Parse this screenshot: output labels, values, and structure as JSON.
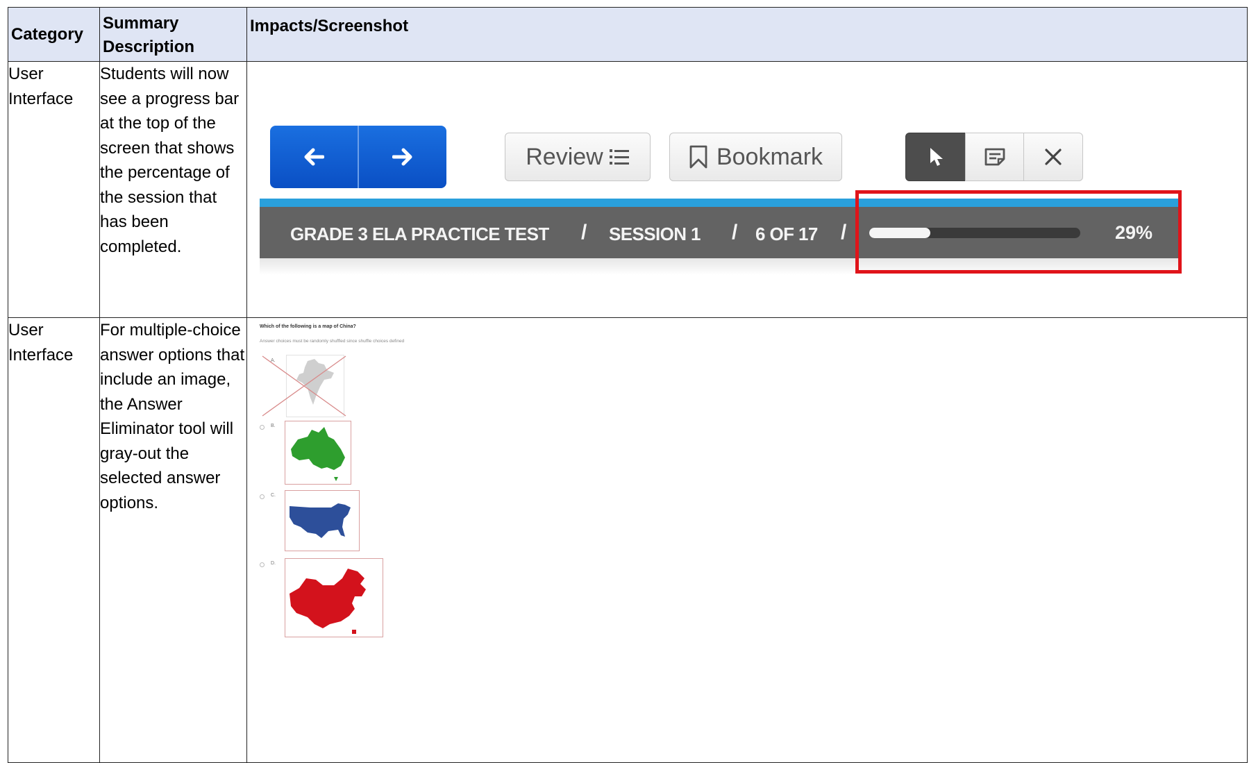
{
  "table": {
    "headers": [
      "Category",
      "Summary Description",
      "Impacts/Screenshot"
    ],
    "rows": [
      {
        "category": "User Interface",
        "summary": "Students will now see a progress bar at the top of the screen that shows the percentage of the session that has been completed."
      },
      {
        "category": "User Interface",
        "summary": "For multiple-choice answer options that include an image, the Answer Eliminator tool will gray-out the selected answer options."
      }
    ]
  },
  "screenshot1": {
    "icons": {
      "prev": "arrow-left-icon",
      "next": "arrow-right-icon",
      "review": "list-icon",
      "bookmark": "bookmark-icon",
      "pointer": "cursor-icon",
      "note": "note-icon",
      "close": "close-icon"
    },
    "review_label": "Review",
    "bookmark_label": "Bookmark",
    "breadcrumb": {
      "test": "GRADE 3 ELA PRACTICE TEST",
      "session": "SESSION 1",
      "position": "6 OF 17",
      "separator": "/"
    },
    "progress": {
      "fraction": 0.29,
      "label": "29%"
    },
    "colors": {
      "nav": "#0a4fc4",
      "accent_line": "#2aa0dc",
      "bar": "#636363",
      "highlight": "#e0141a"
    }
  },
  "screenshot2": {
    "question": "Which of the following is a map of China?",
    "note": "Answer choices must be randomly shuffled since shuffle choices defined",
    "options": [
      {
        "letter": "A.",
        "eliminated": true,
        "color": "#cfcfcf"
      },
      {
        "letter": "B.",
        "eliminated": false,
        "color": "#2e9e2e"
      },
      {
        "letter": "C.",
        "eliminated": false,
        "color": "#2d4f9a"
      },
      {
        "letter": "D.",
        "eliminated": false,
        "color": "#d3121c"
      }
    ]
  }
}
